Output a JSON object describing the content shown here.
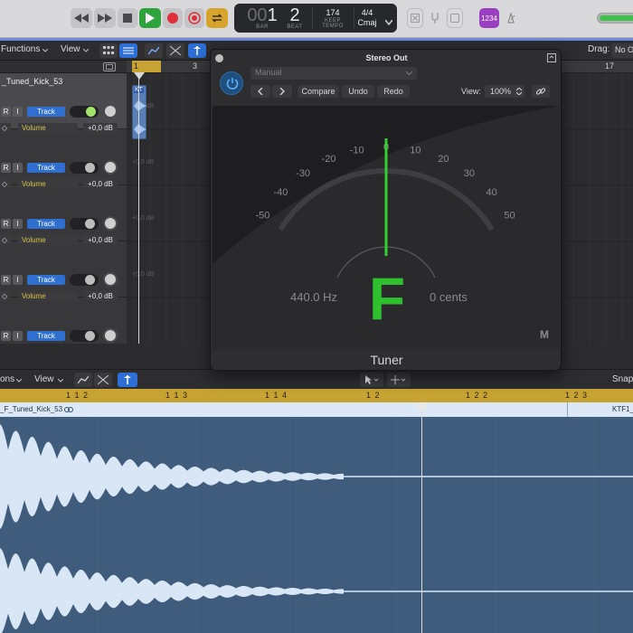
{
  "control_bar": {
    "lcd": {
      "bar": "00",
      "bar_active": "1",
      "beat": "2",
      "bar_label": "BAR",
      "beat_label": "BEAT",
      "tempo": "174",
      "keep_label": "KEEP",
      "tempo_label": "TEMPO",
      "signature": "4/4",
      "key": "Cmaj"
    },
    "count_in": "1234"
  },
  "tracks_toolbar": {
    "functions": "Functions",
    "view": "View",
    "drag_label": "Drag:",
    "drag_value": "No O"
  },
  "ruler": {
    "marks": [
      "1",
      "3",
      "17"
    ]
  },
  "tracks": [
    {
      "name": "_Tuned_Kick_53",
      "r": "R",
      "i": "I",
      "track_btn": "Track",
      "param": "Volume",
      "value": "+0,0 dB",
      "region_value": "+0,0 dB"
    },
    {
      "name": "",
      "r": "R",
      "i": "I",
      "track_btn": "Track",
      "param": "Volume",
      "value": "+0,0 dB",
      "region_value": "+0,0 dB"
    },
    {
      "name": "",
      "r": "R",
      "i": "I",
      "track_btn": "Track",
      "param": "Volume",
      "value": "+0,0 dB",
      "region_value": "+0,0 dB"
    },
    {
      "name": "",
      "r": "R",
      "i": "I",
      "track_btn": "Track",
      "param": "Volume",
      "value": "+0,0 dB",
      "region_value": "+0,0 dB"
    },
    {
      "name": "",
      "r": "R",
      "i": "I",
      "track_btn": "Track",
      "param": "",
      "value": "",
      "region_value": ""
    }
  ],
  "region_label": "KT",
  "plugin": {
    "title": "Stereo Out",
    "preset": "Manual",
    "compare": "Compare",
    "undo": "Undo",
    "redo": "Redo",
    "view_label": "View:",
    "zoom": "100%",
    "scale_labels": [
      "-50",
      "-40",
      "-30",
      "-20",
      "-10",
      "0",
      "10",
      "20",
      "30",
      "40",
      "50"
    ],
    "frequency": "440.0 Hz",
    "note": "F",
    "cents": "0 cents",
    "mode_badge": "M",
    "name": "Tuner",
    "needle_color": "#2fd12f",
    "note_color": "#2fbf2f"
  },
  "editor": {
    "functions": "ons",
    "view": "View",
    "snap": "Snap",
    "ruler_marks": [
      "1 1 2",
      "1 1 3",
      "1 1 4",
      "1 2",
      "1 2 2",
      "1 2 3"
    ],
    "region_name": "_F_Tuned_Kick_53",
    "region_name_right": "KTF1_",
    "wave_color": "#d8e6f6",
    "bg_color": "#3f5c7c"
  }
}
